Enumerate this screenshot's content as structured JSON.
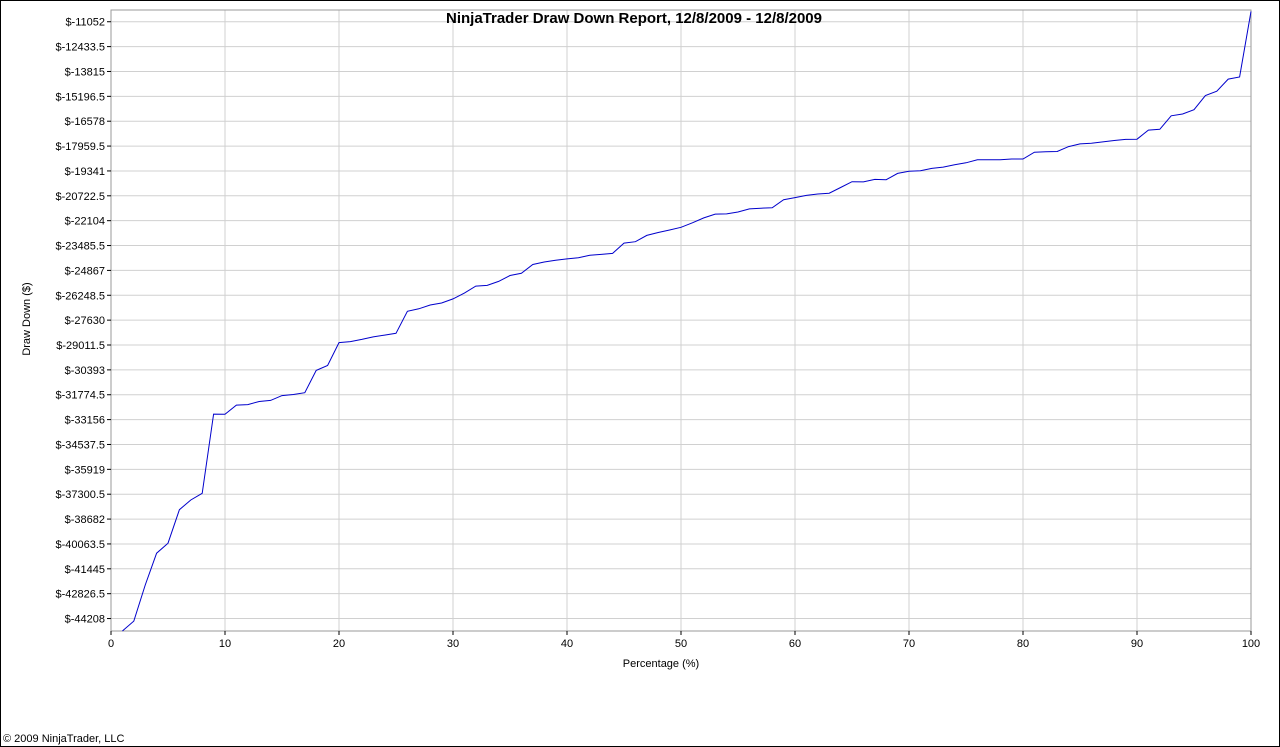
{
  "chart_data": {
    "type": "line",
    "title": "NinjaTrader Draw Down Report, 12/8/2009 - 12/8/2009",
    "xlabel": "Percentage (%)",
    "ylabel": "Draw Down ($)",
    "xlim": [
      0,
      100
    ],
    "ylim": [
      -44900,
      -10400
    ],
    "x_ticks": [
      0,
      10,
      20,
      30,
      40,
      50,
      60,
      70,
      80,
      90,
      100
    ],
    "y_ticks": [
      {
        "value": -11052,
        "label": "$-11052"
      },
      {
        "value": -12433.5,
        "label": "$-12433.5"
      },
      {
        "value": -13815,
        "label": "$-13815"
      },
      {
        "value": -15196.5,
        "label": "$-15196.5"
      },
      {
        "value": -16578,
        "label": "$-16578"
      },
      {
        "value": -17959.5,
        "label": "$-17959.5"
      },
      {
        "value": -19341,
        "label": "$-19341"
      },
      {
        "value": -20722.5,
        "label": "$-20722.5"
      },
      {
        "value": -22104,
        "label": "$-22104"
      },
      {
        "value": -23485.5,
        "label": "$-23485.5"
      },
      {
        "value": -24867,
        "label": "$-24867"
      },
      {
        "value": -26248.5,
        "label": "$-26248.5"
      },
      {
        "value": -27630,
        "label": "$-27630"
      },
      {
        "value": -29011.5,
        "label": "$-29011.5"
      },
      {
        "value": -30393,
        "label": "$-30393"
      },
      {
        "value": -31774.5,
        "label": "$-31774.5"
      },
      {
        "value": -33156,
        "label": "$-33156"
      },
      {
        "value": -34537.5,
        "label": "$-34537.5"
      },
      {
        "value": -35919,
        "label": "$-35919"
      },
      {
        "value": -37300.5,
        "label": "$-37300.5"
      },
      {
        "value": -38682,
        "label": "$-38682"
      },
      {
        "value": -40063.5,
        "label": "$-40063.5"
      },
      {
        "value": -41445,
        "label": "$-41445"
      },
      {
        "value": -42826.5,
        "label": "$-42826.5"
      },
      {
        "value": -44208,
        "label": "$-44208"
      }
    ],
    "grid": true,
    "series": [
      {
        "color": "#0000cc",
        "x": [
          1,
          2,
          3,
          4,
          5,
          6,
          7,
          8,
          9,
          10,
          11,
          12,
          13,
          14,
          15,
          16,
          17,
          18,
          19,
          20,
          21,
          22,
          23,
          24,
          25,
          26,
          27,
          28,
          29,
          30,
          31,
          32,
          33,
          34,
          35,
          36,
          37,
          38,
          39,
          40,
          41,
          42,
          43,
          44,
          45,
          46,
          47,
          48,
          49,
          50,
          51,
          52,
          53,
          54,
          55,
          56,
          57,
          58,
          59,
          60,
          61,
          62,
          63,
          64,
          65,
          66,
          67,
          68,
          69,
          70,
          71,
          72,
          73,
          74,
          75,
          76,
          77,
          78,
          79,
          80,
          81,
          82,
          83,
          84,
          85,
          86,
          87,
          88,
          89,
          90,
          91,
          92,
          93,
          94,
          95,
          96,
          97,
          98,
          99,
          100
        ],
        "values": [
          -44900,
          -44350,
          -42350,
          -40580,
          -40020,
          -38160,
          -37620,
          -37250,
          -32850,
          -32860,
          -32350,
          -32320,
          -32150,
          -32090,
          -31820,
          -31760,
          -31660,
          -30420,
          -30150,
          -28880,
          -28820,
          -28700,
          -28560,
          -28460,
          -28360,
          -27140,
          -27000,
          -26790,
          -26680,
          -26450,
          -26130,
          -25740,
          -25700,
          -25480,
          -25150,
          -25030,
          -24540,
          -24400,
          -24300,
          -24230,
          -24160,
          -24020,
          -23980,
          -23920,
          -23350,
          -23270,
          -22920,
          -22760,
          -22620,
          -22470,
          -22220,
          -21950,
          -21740,
          -21730,
          -21620,
          -21450,
          -21410,
          -21390,
          -20940,
          -20820,
          -20700,
          -20620,
          -20580,
          -20260,
          -19940,
          -19950,
          -19810,
          -19830,
          -19480,
          -19360,
          -19330,
          -19200,
          -19130,
          -19000,
          -18890,
          -18720,
          -18720,
          -18720,
          -18680,
          -18680,
          -18300,
          -18270,
          -18260,
          -17990,
          -17840,
          -17800,
          -17730,
          -17650,
          -17590,
          -17580,
          -17070,
          -17030,
          -16280,
          -16180,
          -15940,
          -15150,
          -14910,
          -14240,
          -14120,
          -10480
        ]
      }
    ]
  },
  "footer": {
    "copyright": "© 2009 NinjaTrader, LLC"
  }
}
